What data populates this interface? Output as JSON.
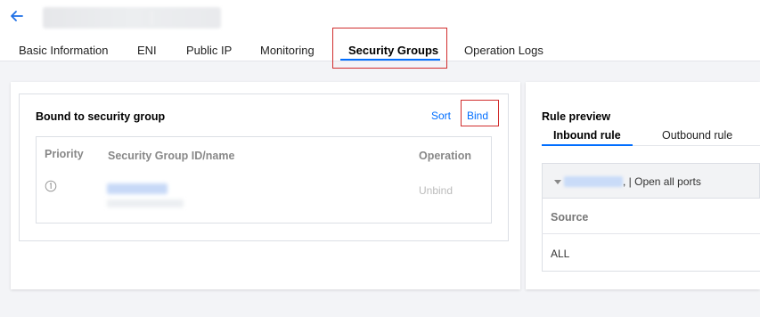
{
  "header": {
    "tabs": [
      {
        "label": "Basic Information",
        "active": false
      },
      {
        "label": "ENI",
        "active": false
      },
      {
        "label": "Public IP",
        "active": false
      },
      {
        "label": "Monitoring",
        "active": false
      },
      {
        "label": "Security Groups",
        "active": true
      },
      {
        "label": "Operation Logs",
        "active": false
      }
    ]
  },
  "bound_panel": {
    "title": "Bound to security group",
    "sort_label": "Sort",
    "bind_label": "Bind",
    "columns": [
      "Priority",
      "Security Group ID/name",
      "Operation"
    ],
    "rows": [
      {
        "operation": "Unbind"
      }
    ]
  },
  "rule_preview": {
    "title": "Rule preview",
    "tabs": [
      {
        "label": "Inbound rule",
        "active": true
      },
      {
        "label": "Outbound rule",
        "active": false
      }
    ],
    "group_suffix": ", | Open all ports",
    "columns": [
      "Source"
    ],
    "rows": [
      {
        "source": "ALL"
      }
    ]
  },
  "colors": {
    "accent": "#006eff",
    "highlight_border": "#d12d2d"
  },
  "icons": {
    "back": "arrow-left-icon",
    "priority_info": "info-circle-icon",
    "group_toggle": "caret-down-icon"
  }
}
